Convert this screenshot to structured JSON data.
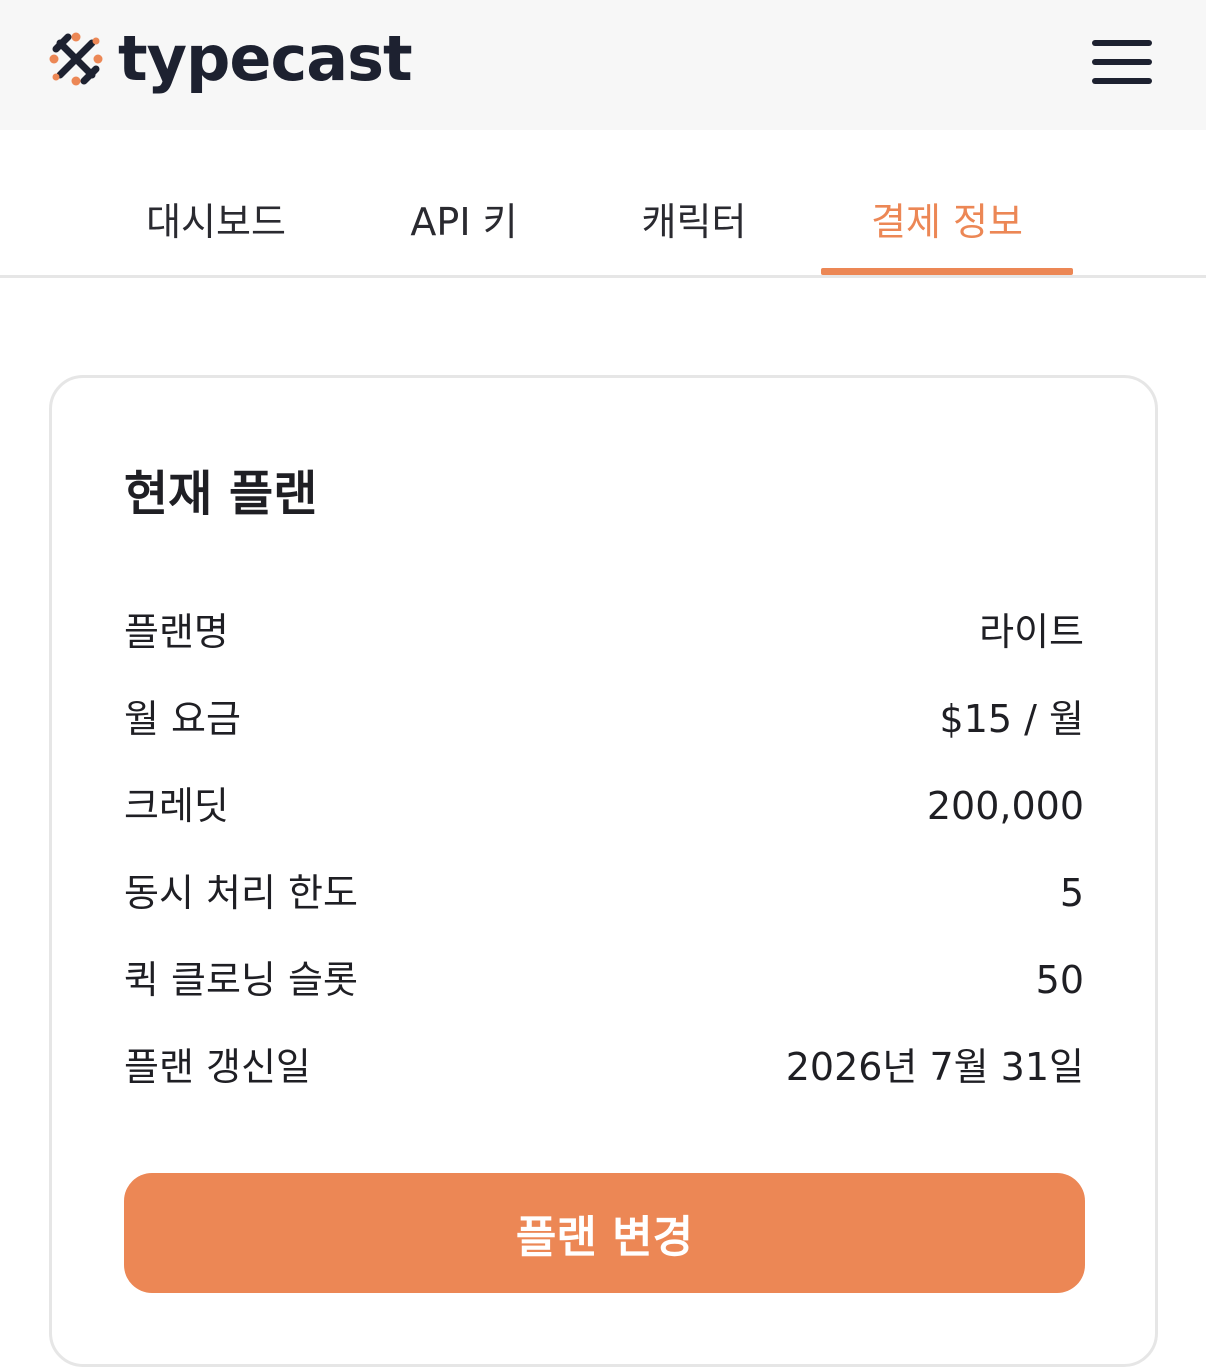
{
  "header": {
    "logo_text": "typecast",
    "menu_icon": "hamburger-menu-icon",
    "background": "#f7f7f7"
  },
  "tabs": [
    {
      "label": "대시보드",
      "active": false
    },
    {
      "label": "API 키",
      "active": false
    },
    {
      "label": "캐릭터",
      "active": false
    },
    {
      "label": "결제 정보",
      "active": true
    }
  ],
  "card": {
    "title": "현재 플랜",
    "rows": [
      {
        "label": "플랜명",
        "value": "라이트"
      },
      {
        "label": "월 요금",
        "value": "$15 / 월"
      },
      {
        "label": "크레딧",
        "value": "200,000"
      },
      {
        "label": "동시 처리 한도",
        "value": "5"
      },
      {
        "label": "퀵 클로닝 슬롯",
        "value": "50"
      },
      {
        "label": "플랜 갱신일",
        "value": "2026년 7월 31일"
      }
    ],
    "button_label": "플랜 변경"
  },
  "colors": {
    "accent": "#ec8755",
    "text": "#1f1f24",
    "logo_dark": "#1d2130",
    "border": "#e6e6e6"
  }
}
